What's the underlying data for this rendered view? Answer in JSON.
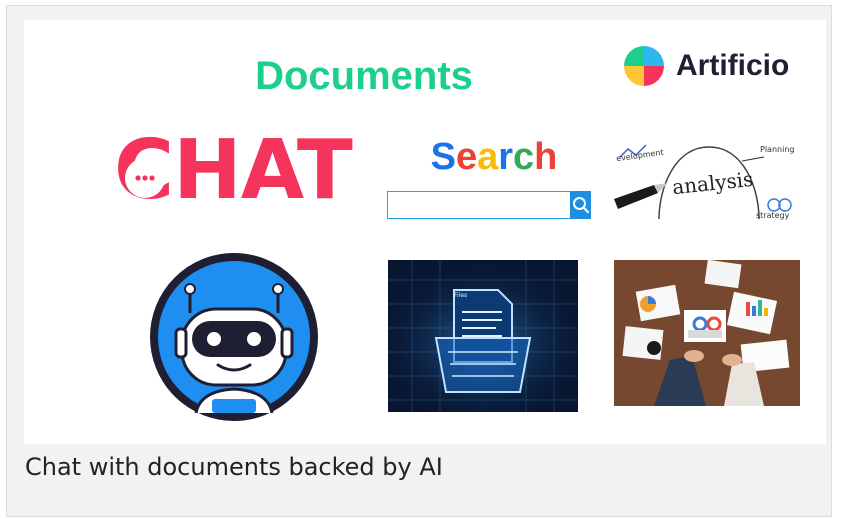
{
  "title": "Documents",
  "brand": {
    "name": "Artificio"
  },
  "chat_logo": {
    "text": "CHAT",
    "color": "#f5345e"
  },
  "search_logo": {
    "letters": [
      "S",
      "e",
      "a",
      "r",
      "c",
      "h"
    ],
    "colors": [
      "#1a73e8",
      "#ea4335",
      "#fbbc05",
      "#1a73e8",
      "#34a853",
      "#ea4335"
    ],
    "input_value": "",
    "button_icon": "magnifier-icon"
  },
  "analysis_image": {
    "center_word": "analysis",
    "words": [
      "evelopment",
      "Planning",
      "strategy"
    ]
  },
  "folder_image": {
    "label": "Files"
  },
  "caption": "Chat with documents backed by AI",
  "colors": {
    "title": "#1ccf8a",
    "brand": "#1f1f33",
    "search_button": "#1e8fe0"
  }
}
